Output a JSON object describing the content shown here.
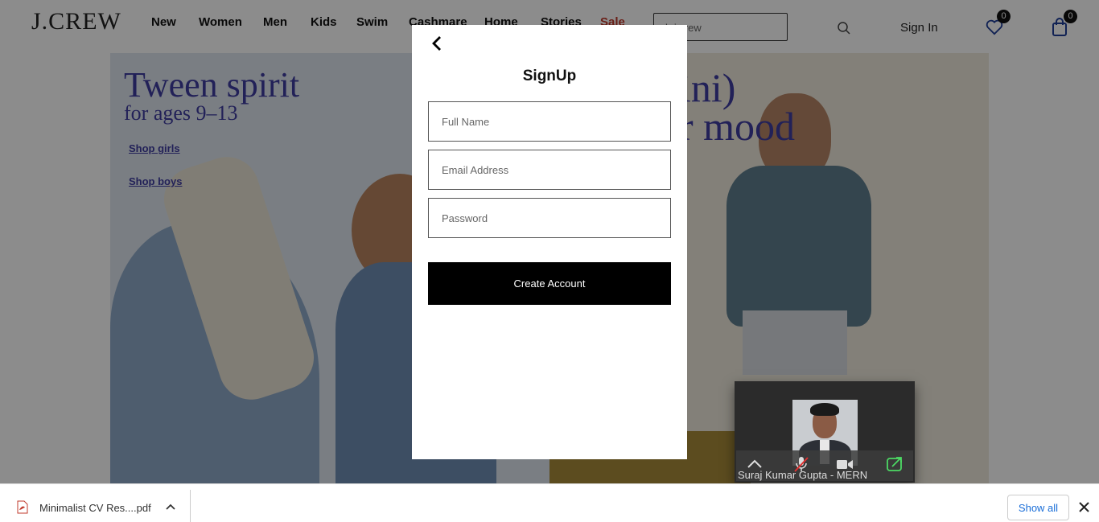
{
  "header": {
    "logo": "J.CREW",
    "nav": [
      "New",
      "Women",
      "Men",
      "Kids",
      "Swim",
      "Cashmare",
      "Home",
      "Stories",
      "Sale"
    ],
    "search_text": "h j.crew",
    "sign_in": "Sign In",
    "wishlist_count": "0",
    "cart_count": "0"
  },
  "hero": {
    "left_title": "Tween spirit",
    "left_sub": "for ages 9–13",
    "link_girls": "Shop girls",
    "link_boys": "Shop boys",
    "right_title": "ini)",
    "right_sub": "r mood"
  },
  "modal": {
    "title": "SignUp",
    "full_name_placeholder": "Full Name",
    "email_placeholder": "Email Address",
    "password_placeholder": "Password",
    "create_button": "Create Account"
  },
  "video_call": {
    "participant": "Suraj Kumar Gupta - MERN"
  },
  "download_bar": {
    "file_name": "Minimalist CV Res....pdf",
    "show_all": "Show all"
  },
  "colors": {
    "sale": "#c0392b",
    "brand_text": "#3f3ca0",
    "button_bg": "#000000",
    "link_blue": "#1a6ed8"
  }
}
